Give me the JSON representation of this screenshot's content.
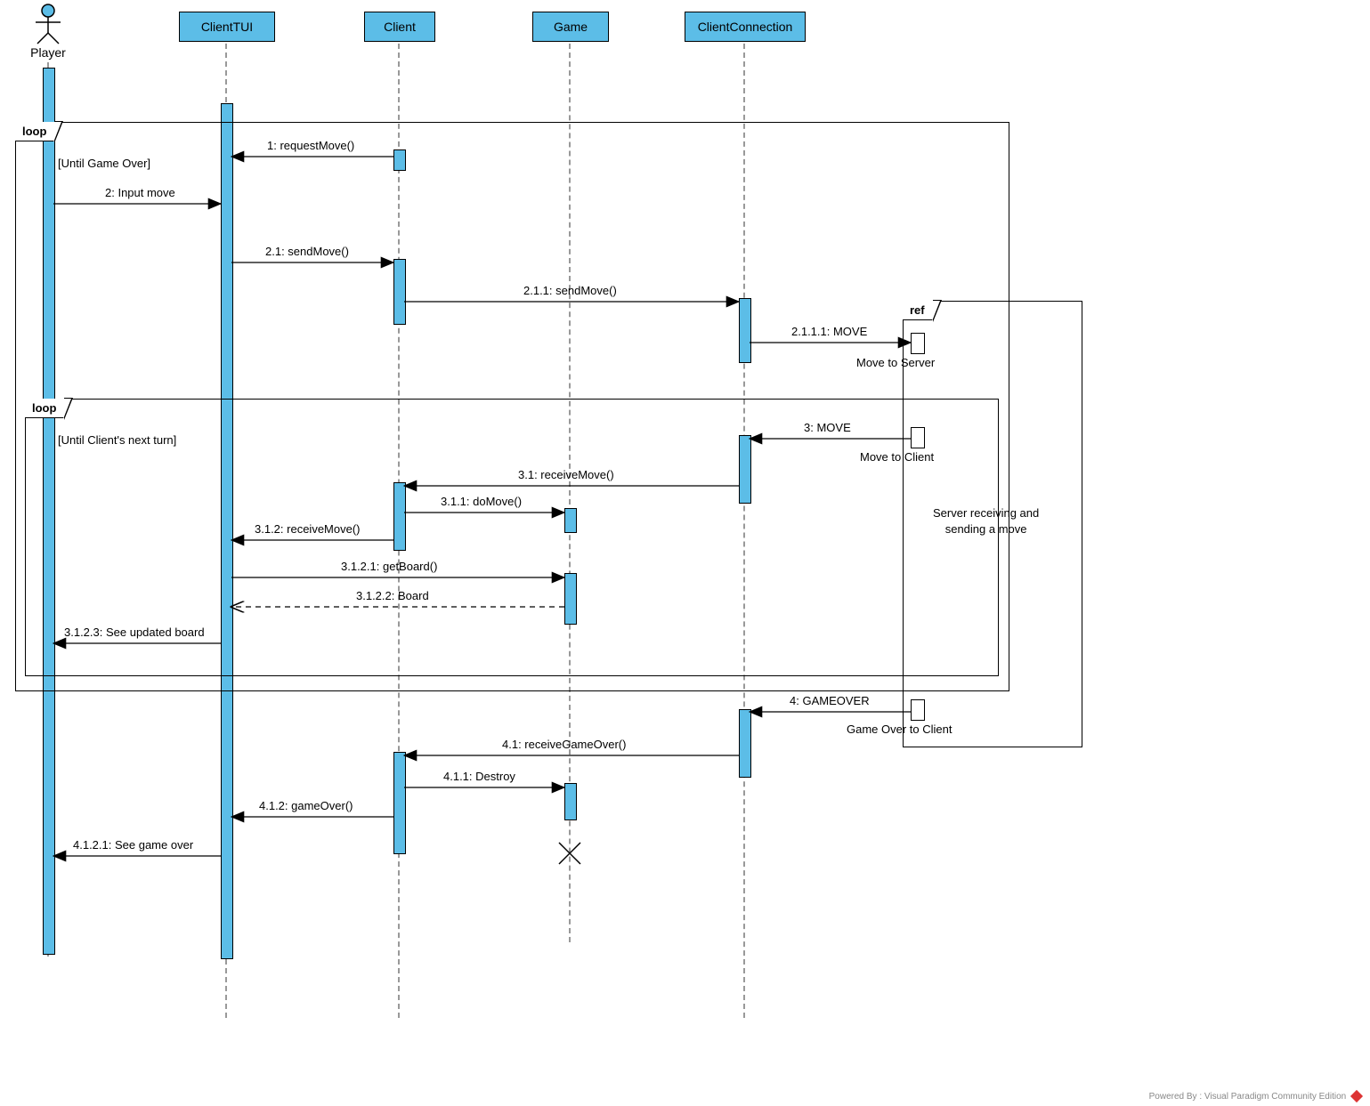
{
  "actor": {
    "name": "Player"
  },
  "lifelines": {
    "clientTUI": "ClientTUI",
    "client": "Client",
    "game": "Game",
    "clientConnection": "ClientConnection"
  },
  "frames": {
    "outerLoop": {
      "tag": "loop",
      "guard": "[Until Game Over]"
    },
    "innerLoop": {
      "tag": "loop",
      "guard": "[Until Client's next turn]"
    },
    "ref": {
      "tag": "ref",
      "label": "Server receiving and\nsending a move"
    }
  },
  "refNotes": {
    "moveToServer": "Move to Server",
    "moveToClient": "Move to Client",
    "gameOverToClient": "Game Over to Client"
  },
  "messages": {
    "m1": "1: requestMove()",
    "m2": "2: Input move",
    "m21": "2.1: sendMove()",
    "m211": "2.1.1: sendMove()",
    "m2111": "2.1.1.1: MOVE",
    "m3": "3: MOVE",
    "m31": "3.1: receiveMove()",
    "m311": "3.1.1: doMove()",
    "m312": "3.1.2: receiveMove()",
    "m3121": "3.1.2.1: getBoard()",
    "m3122": "3.1.2.2: Board",
    "m3123": "3.1.2.3: See updated board",
    "m4": "4: GAMEOVER",
    "m41": "4.1: receiveGameOver()",
    "m411": "4.1.1: Destroy",
    "m412": "4.1.2: gameOver()",
    "m4121": "4.1.2.1: See game over"
  },
  "footer": "Powered By : Visual Paradigm Community Edition"
}
